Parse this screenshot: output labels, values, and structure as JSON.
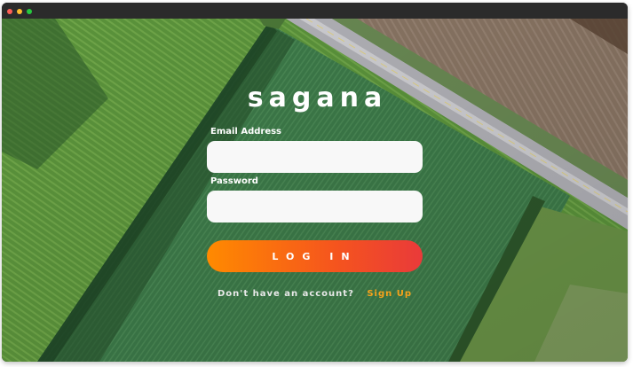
{
  "window": {
    "controls": [
      "close",
      "minimize",
      "maximize"
    ]
  },
  "brand": {
    "name": "sagana"
  },
  "form": {
    "email_label": "Email Address",
    "email_value": "",
    "password_label": "Password",
    "password_value": "",
    "login_label": "LOG IN"
  },
  "signup": {
    "prompt": "Don't have an account?",
    "link_label": "Sign Up"
  },
  "colors": {
    "accent_start": "#ff8a00",
    "accent_end": "#e93a3a",
    "signup_link": "#f7a21b"
  }
}
